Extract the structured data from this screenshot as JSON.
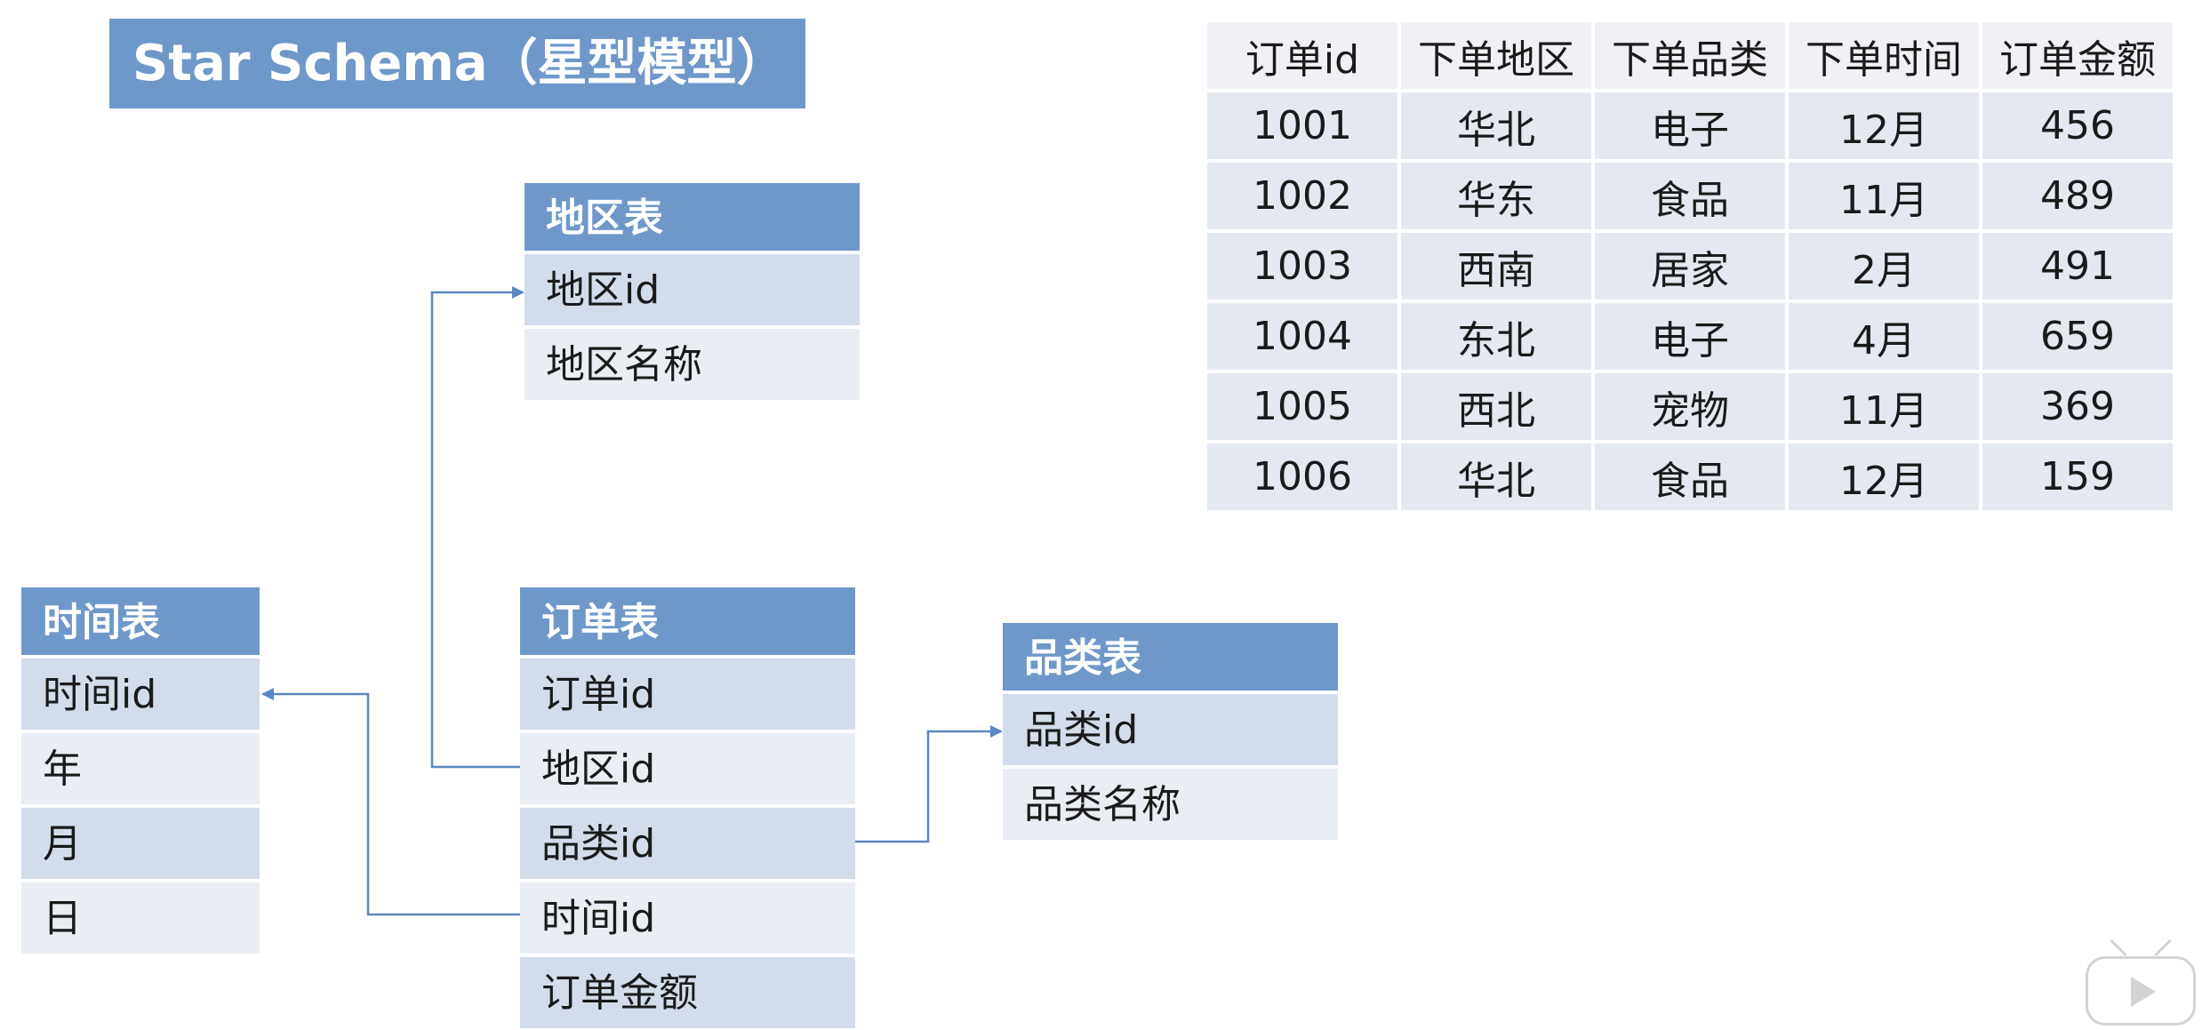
{
  "title": "Star Schema（星型模型）",
  "colors": {
    "header": "#6f98ca",
    "row_dark": "#d3dcea",
    "row_light": "#e9edf4",
    "connector": "#5b87c0"
  },
  "entities": {
    "region": {
      "title": "地区表",
      "fields": [
        "地区id",
        "地区名称"
      ]
    },
    "time": {
      "title": "时间表",
      "fields": [
        "时间id",
        "年",
        "月",
        "日"
      ]
    },
    "order": {
      "title": "订单表",
      "fields": [
        "订单id",
        "地区id",
        "品类id",
        "时间id",
        "订单金额"
      ]
    },
    "category": {
      "title": "品类表",
      "fields": [
        "品类id",
        "品类名称"
      ]
    }
  },
  "relationships": [
    {
      "from": "订单表.地区id",
      "to": "地区表.地区id"
    },
    {
      "from": "订单表.时间id",
      "to": "时间表.时间id"
    },
    {
      "from": "订单表.品类id",
      "to": "品类表.品类id"
    }
  ],
  "table": {
    "headers": [
      "订单id",
      "下单地区",
      "下单品类",
      "下单时间",
      "订单金额"
    ],
    "rows": [
      [
        "1001",
        "华北",
        "电子",
        "12月",
        "456"
      ],
      [
        "1002",
        "华东",
        "食品",
        "11月",
        "489"
      ],
      [
        "1003",
        "西南",
        "居家",
        "2月",
        "491"
      ],
      [
        "1004",
        "东北",
        "电子",
        "4月",
        "659"
      ],
      [
        "1005",
        "西北",
        "宠物",
        "11月",
        "369"
      ],
      [
        "1006",
        "华北",
        "食品",
        "12月",
        "159"
      ]
    ]
  },
  "overlay": {
    "icon": "video-play-icon"
  }
}
